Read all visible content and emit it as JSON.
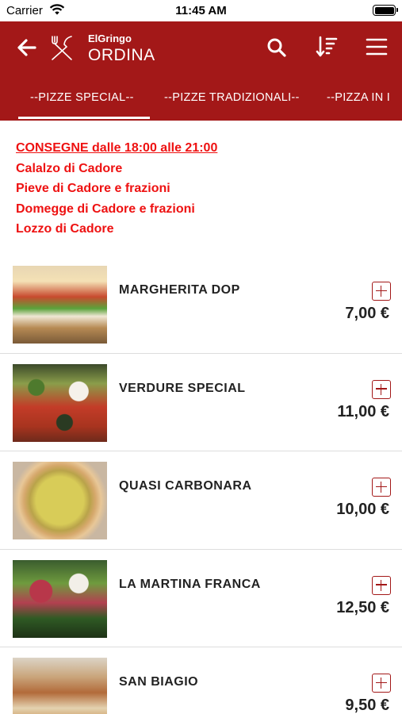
{
  "status_bar": {
    "carrier": "Carrier",
    "time": "11:45 AM"
  },
  "header": {
    "subtitle": "ElGringo",
    "title": "ORDINA",
    "tabs": [
      "--PIZZE SPECIAL--",
      "--PIZZE TRADIZIONALI--",
      "--PIZZA IN I"
    ]
  },
  "notice": {
    "heading": "CONSEGNE dalle 18:00 alle 21:00",
    "lines": [
      "Calalzo di Cadore",
      "Pieve di Cadore e frazioni",
      "Domegge di Cadore e frazioni",
      "Lozzo di Cadore"
    ]
  },
  "products": [
    {
      "name": "MARGHERITA DOP",
      "price": "7,00 €"
    },
    {
      "name": "VERDURE SPECIAL",
      "price": "11,00 €"
    },
    {
      "name": "QUASI CARBONARA",
      "price": "10,00 €"
    },
    {
      "name": "LA MARTINA FRANCA",
      "price": "12,50 €"
    },
    {
      "name": "SAN BIAGIO",
      "price": "9,50 €"
    }
  ],
  "colors": {
    "brand": "#a31818",
    "notice": "#ee1111"
  },
  "icons": [
    "back-arrow-icon",
    "cutlery-icon",
    "search-icon",
    "sort-icon",
    "hamburger-menu-icon",
    "plus-square-icon"
  ]
}
